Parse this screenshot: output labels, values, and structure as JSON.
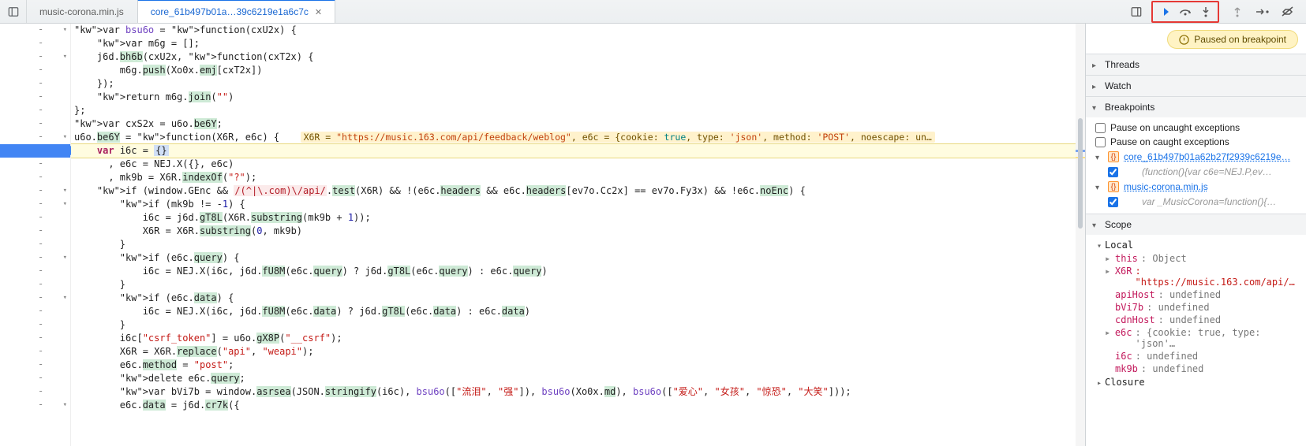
{
  "tabs": {
    "t1": "music-corona.min.js",
    "t2": "core_61b497b01a…39c6219e1a6c7c"
  },
  "toolbar_icons": {
    "panel_right": "panel-right",
    "resume": "▶",
    "step_over": "↻",
    "step_into": "↧",
    "step_out": "↥",
    "step": "→•",
    "deactivate": "⊘"
  },
  "paused_label": "Paused on breakpoint",
  "inline_vals": "X6R = \"https://music.163.com/api/feedback/weblog\", e6c = {cookie: true, type: 'json', method: 'POST', noescape: un…",
  "code": {
    "l1": "var bsu6o = function(cxU2x) {",
    "l2": "    var m6g = [];",
    "l3": "    j6d.bh6b(cxU2x, function(cxT2x) {",
    "l4": "        m6g.push(Xo0x.emj[cxT2x])",
    "l5": "    });",
    "l6": "    return m6g.join(\"\")",
    "l7": "};",
    "l8": "var cxS2x = u6o.be6Y;",
    "l9a": "u6o.be6Y = function(X6R, e6c) {",
    "l10": "    var i6c = {}",
    "l11": "      , e6c = NEJ.X({}, e6c)",
    "l12": "      , mk9b = X6R.indexOf(\"?\");",
    "l13": "    if (window.GEnc && /(^|\\.com)\\/api/.test(X6R) && !(e6c.headers && e6c.headers[ev7o.Cc2x] == ev7o.Fy3x) && !e6c.noEnc) {",
    "l14": "        if (mk9b != -1) {",
    "l15": "            i6c = j6d.gT8L(X6R.substring(mk9b + 1));",
    "l16": "            X6R = X6R.substring(0, mk9b)",
    "l17": "        }",
    "l18": "        if (e6c.query) {",
    "l19": "            i6c = NEJ.X(i6c, j6d.fU8M(e6c.query) ? j6d.gT8L(e6c.query) : e6c.query)",
    "l20": "        }",
    "l21": "        if (e6c.data) {",
    "l22": "            i6c = NEJ.X(i6c, j6d.fU8M(e6c.data) ? j6d.gT8L(e6c.data) : e6c.data)",
    "l23": "        }",
    "l24": "        i6c[\"csrf_token\"] = u6o.gX8P(\"__csrf\");",
    "l25": "        X6R = X6R.replace(\"api\", \"weapi\");",
    "l26": "        e6c.method = \"post\";",
    "l27": "        delete e6c.query;",
    "l28": "        var bVi7b = window.asrsea(JSON.stringify(i6c), bsu6o([\"流泪\", \"强\"]), bsu6o(Xo0x.md), bsu6o([\"爱心\", \"女孩\", \"惊恐\", \"大笑\"]));",
    "l29": "        e6c.data = j6d.cr7k({"
  },
  "side": {
    "threads": "Threads",
    "watch": "Watch",
    "breakpoints": "Breakpoints",
    "pause_uncaught": "Pause on uncaught exceptions",
    "pause_caught": "Pause on caught exceptions",
    "file1": "core_61b497b01a62b27f2939c6219e…",
    "file1_snip": "(function(){var c6e=NEJ.P,ev…",
    "file2": "music-corona.min.js",
    "file2_snip": "var _MusicCorona=function(){…",
    "scope": "Scope",
    "local": "Local",
    "closure": "Closure",
    "this_k": "this",
    "this_v": ": Object",
    "x6r_k": "X6R",
    "x6r_v": ": \"https://music.163.com/api/…",
    "apiHost_k": "apiHost",
    "undef": ": undefined",
    "bVi7b_k": "bVi7b",
    "cdnHost_k": "cdnHost",
    "e6c_k": "e6c",
    "e6c_v": ": {cookie: true, type: 'json'…",
    "i6c_k": "i6c",
    "mk9b_k": "mk9b"
  }
}
